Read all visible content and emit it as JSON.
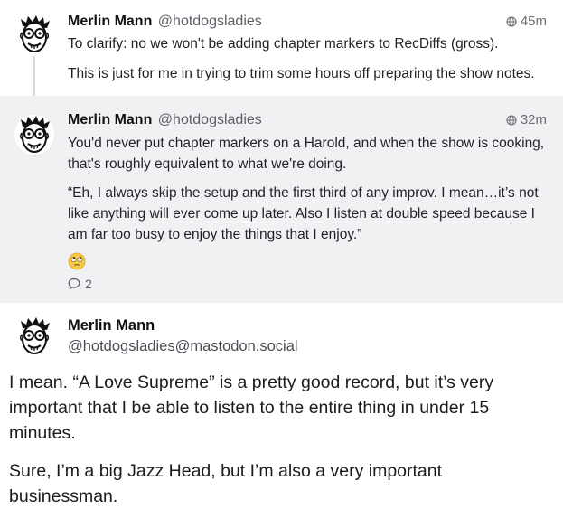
{
  "posts": [
    {
      "author": "Merlin Mann",
      "handle": "@hotdogsladies",
      "time": "45m",
      "paragraphs": [
        "To clarify: no we won't be adding chapter markers to RecDiffs (gross).",
        "This is just for me in trying to trim some hours off preparing the show notes."
      ]
    },
    {
      "author": "Merlin Mann",
      "handle": "@hotdogsladies",
      "time": "32m",
      "paragraphs": [
        "You'd never put chapter markers on a Harold, and when the show is cooking, that's roughly equivalent to what we're doing.",
        "“Eh, I always skip the setup and the first third of any improv. I mean…it’s not like anything will ever come up later. Also I listen at double speed because I am far too busy to enjoy the things that I enjoy.”"
      ],
      "emoji": "face-with-rolling-eyes",
      "reply_count": "2"
    },
    {
      "author": "Merlin Mann",
      "handle": "@hotdogsladies@mastodon.social",
      "paragraphs": [
        "I mean. “A Love Supreme” is a pretty good record, but it’s very important that I be able to listen to the entire thing in under 15 minutes.",
        "Sure, I’m a big Jazz Head, but I’m also a very important businessman."
      ]
    }
  ],
  "colors": {
    "highlight_bg": "#f1f1f4",
    "muted": "#5c5f66",
    "thread_line": "#d7d7dd"
  }
}
